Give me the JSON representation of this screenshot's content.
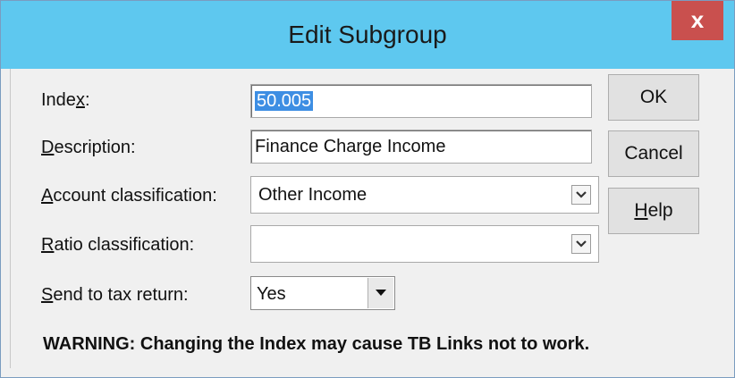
{
  "window": {
    "title": "Edit Subgroup",
    "close_label": "x"
  },
  "form": {
    "index": {
      "label": "Index:",
      "value": "50.005"
    },
    "description": {
      "label": "Description:",
      "value": "Finance Charge Income"
    },
    "account_classification": {
      "label": "Account classification:",
      "value": "Other Income"
    },
    "ratio_classification": {
      "label": "Ratio classification:",
      "value": ""
    },
    "send_to_tax_return": {
      "label": "Send to tax return:",
      "value": "Yes"
    }
  },
  "buttons": {
    "ok": "OK",
    "cancel": "Cancel",
    "help": "Help"
  },
  "warning": "WARNING: Changing the Index may cause TB Links not to work.",
  "icons": {
    "combo_arrow": "chevron-down-icon",
    "dropdown_arrow": "triangle-down-icon",
    "close": "close-icon"
  }
}
